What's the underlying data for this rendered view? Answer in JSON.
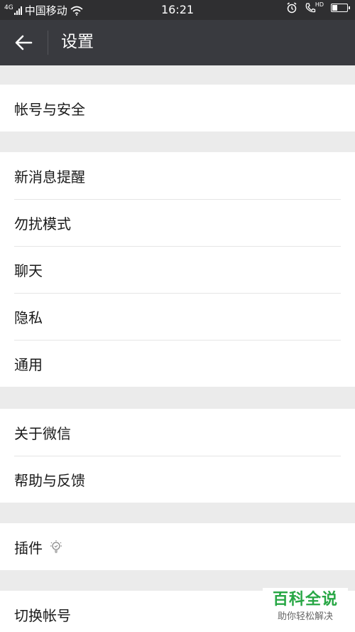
{
  "status_bar": {
    "network": "4G",
    "carrier": "中国移动",
    "time": "16:21",
    "hd": "HD",
    "battery_level": 0.4
  },
  "header": {
    "title": "设置"
  },
  "groups": [
    {
      "items": [
        {
          "label": "帐号与安全"
        }
      ]
    },
    {
      "items": [
        {
          "label": "新消息提醒"
        },
        {
          "label": "勿扰模式"
        },
        {
          "label": "聊天"
        },
        {
          "label": "隐私"
        },
        {
          "label": "通用"
        }
      ]
    },
    {
      "items": [
        {
          "label": "关于微信"
        },
        {
          "label": "帮助与反馈"
        }
      ]
    },
    {
      "items": [
        {
          "label": "插件"
        }
      ]
    },
    {
      "items": [
        {
          "label": "切换帐号"
        }
      ]
    }
  ],
  "watermark": {
    "title": "百科全说",
    "subtitle": "助你轻松解决"
  },
  "colors": {
    "status_bar_bg": "#2f2f31",
    "title_bar_bg": "#393a3f",
    "page_bg": "#ebebeb",
    "watermark_green": "#28a745"
  },
  "icons": {
    "back": "arrow-left-icon",
    "wifi": "wifi-icon",
    "signal": "signal-bars-icon",
    "alarm": "alarm-clock-icon",
    "hd_call": "hd-call-icon",
    "battery": "battery-icon",
    "plugin": "lightbulb-icon"
  }
}
